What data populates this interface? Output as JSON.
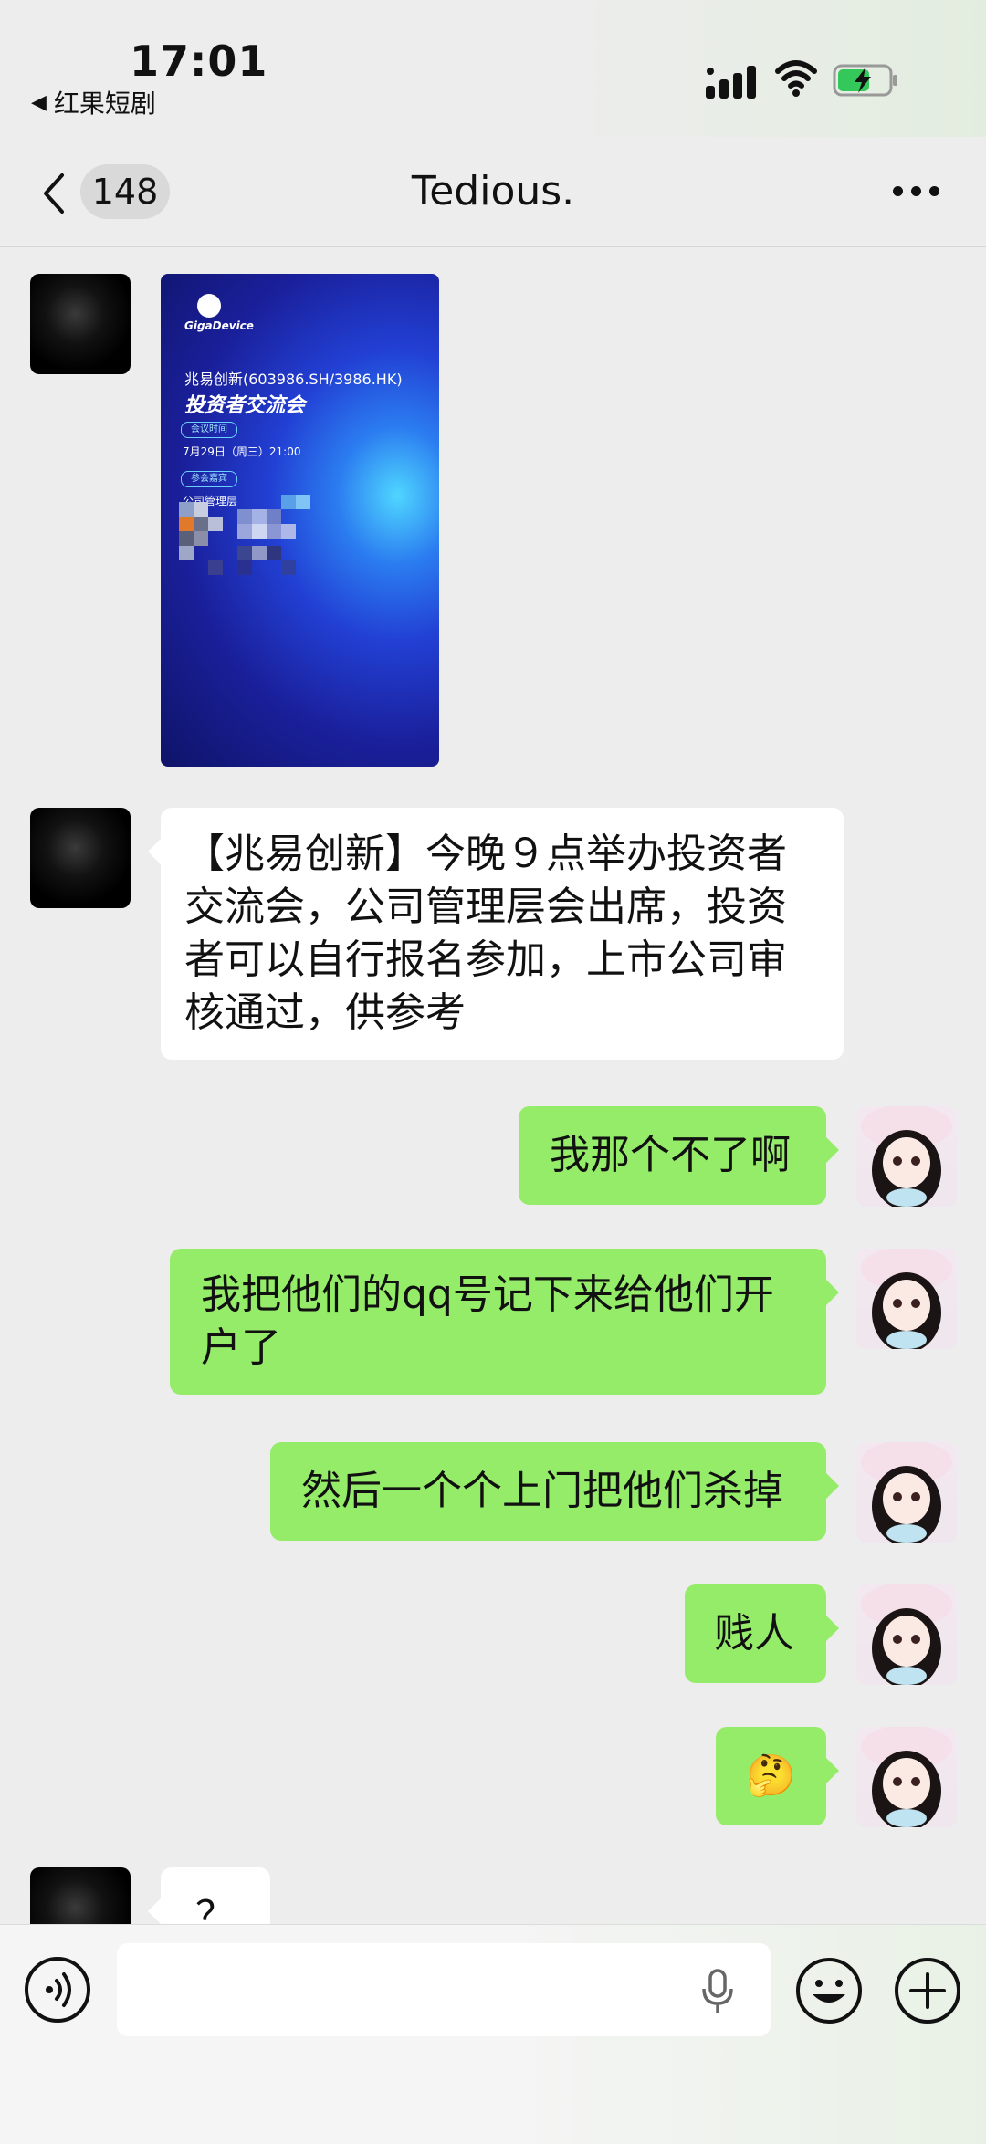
{
  "status": {
    "time": "17:01",
    "back_app": "红果短剧"
  },
  "nav": {
    "badge": "148",
    "title": "Tedious."
  },
  "poster": {
    "brand": "GigaDevice",
    "company_line": "兆易创新(603986.SH/3986.HK)",
    "event_title": "投资者交流会",
    "tag_time": "会议时间",
    "time_text": "7月29日（周三）21:00",
    "tag_guest": "参会嘉宾",
    "guest_text": "公司管理层"
  },
  "messages": [
    {
      "side": "left",
      "text": "【兆易创新】今晚９点举办投资者交流会，公司管理层会出席，投资者可以自行报名参加，上市公司审核通过，供参考"
    },
    {
      "side": "right",
      "text": "我那个不了啊"
    },
    {
      "side": "right",
      "text": "我把他们的qq号记下来给他们开户了"
    },
    {
      "side": "right",
      "text": "然后一个个上门把他们杀掉"
    },
    {
      "side": "right",
      "text": "贱人"
    },
    {
      "side": "right",
      "text": "🤔"
    },
    {
      "side": "left",
      "text": "？"
    }
  ],
  "icons": {
    "nav_back": "chevron-left-icon",
    "more": "ellipsis-icon",
    "voice": "voice-icon",
    "mic": "microphone-icon",
    "emoji": "smiley-icon",
    "plus": "plus-icon"
  },
  "colors": {
    "bubble_self": "#95ec69",
    "bubble_other": "#ffffff",
    "background": "#ededed"
  }
}
